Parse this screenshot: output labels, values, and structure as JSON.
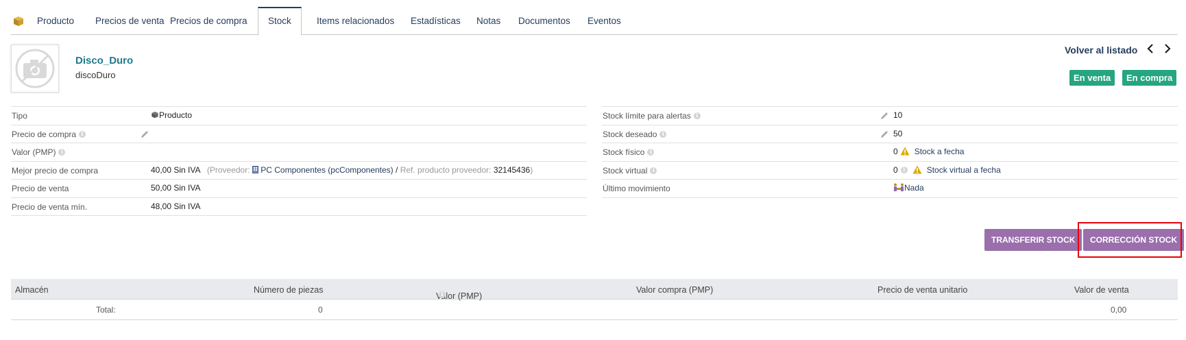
{
  "tabs": [
    {
      "label": "Producto"
    },
    {
      "label": "Precios de venta"
    },
    {
      "label": "Precios de compra"
    },
    {
      "label": "Stock"
    },
    {
      "label": "Items relacionados"
    },
    {
      "label": "Estadísticas"
    },
    {
      "label": "Notas"
    },
    {
      "label": "Documentos"
    },
    {
      "label": "Eventos"
    }
  ],
  "header": {
    "ref": "Disco_Duro",
    "label": "discoDuro",
    "back_link": "Volver al listado",
    "prev_icon": "chevron-left-icon",
    "next_icon": "chevron-right-icon",
    "badges": [
      "En venta",
      "En compra"
    ]
  },
  "left_fields": [
    {
      "label": "Tipo",
      "value": "Producto"
    },
    {
      "label": "Precio de compra",
      "value": ""
    },
    {
      "label": "Valor (PMP)",
      "value": ""
    },
    {
      "label": "Mejor precio de compra",
      "value": "40,00 Sin IVA",
      "supplier_prefix": "(Proveedor:",
      "supplier_name": "PC Componentes (pcComponentes)",
      "sep": "/",
      "ref_label": "Ref. producto proveedor:",
      "ref_value": "32145436",
      "close": ")"
    },
    {
      "label": "Precio de venta",
      "value": "50,00 Sin IVA"
    },
    {
      "label": "Precio de venta mín.",
      "value": "48,00 Sin IVA"
    }
  ],
  "right_fields": [
    {
      "label": "Stock límite para alertas",
      "value": "10"
    },
    {
      "label": "Stock deseado",
      "value": "50"
    },
    {
      "label": "Stock físico",
      "value": "0",
      "link": "Stock a fecha"
    },
    {
      "label": "Stock virtual",
      "value": "0",
      "link": "Stock virtual a fecha"
    },
    {
      "label": "Último movimiento",
      "value": "Nada"
    }
  ],
  "buttons": {
    "transfer": "TRANSFERIR STOCK",
    "correction": "CORRECCIÓN STOCK"
  },
  "stock_table": {
    "headers": [
      "Almacén",
      "Número de piezas",
      "Valor (PMP)",
      "Valor compra (PMP)",
      "Precio de venta unitario",
      "Valor de venta"
    ],
    "total_label": "Total:",
    "total_pieces": "0",
    "total_sale_value": "0,00"
  },
  "colors": {
    "accent": "#263c5c",
    "badge_green": "#25a580",
    "button_purple": "#9a6fab",
    "highlight_red": "#e8000b"
  }
}
